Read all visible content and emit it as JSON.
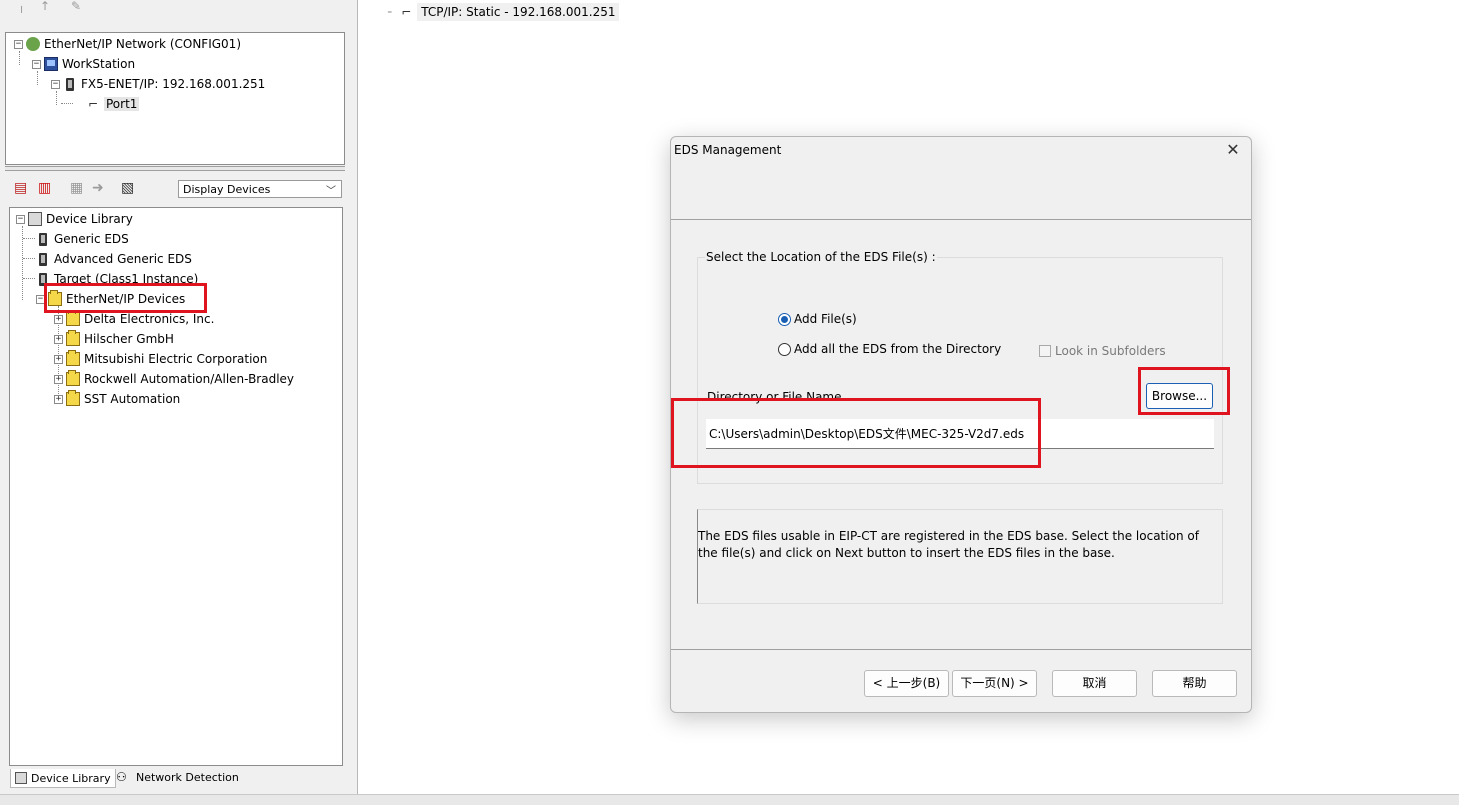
{
  "network_tree": {
    "root_label": "EtherNet/IP Network (CONFIG01)",
    "workstation_label": "WorkStation",
    "device_label": "FX5-ENET/IP: 192.168.001.251",
    "port_label": "Port1"
  },
  "library_toolbar": {
    "display_select_value": "Display Devices"
  },
  "library_tree": {
    "root_label": "Device Library",
    "items": [
      {
        "label": "Generic EDS"
      },
      {
        "label": "Advanced Generic EDS"
      },
      {
        "label": "Target (Class1 Instance)"
      },
      {
        "label": "EtherNet/IP Devices"
      }
    ],
    "vendors": [
      {
        "label": "Delta Electronics, Inc."
      },
      {
        "label": "Hilscher GmbH"
      },
      {
        "label": "Mitsubishi Electric Corporation"
      },
      {
        "label": "Rockwell Automation/Allen-Bradley"
      },
      {
        "label": "SST Automation"
      }
    ]
  },
  "bottom_tabs": {
    "device_library": "Device Library",
    "network_detection": "Network Detection"
  },
  "header": {
    "tcpip_label": "TCP/IP: Static - 192.168.001.251"
  },
  "dialog": {
    "title": "EDS Management",
    "close_glyph": "✕",
    "location_group_label": "Select the Location of the EDS File(s) :",
    "radio_add_files": "Add File(s)",
    "radio_add_directory": "Add all the EDS from the Directory",
    "checkbox_subfolders": "Look in Subfolders",
    "directory_label": "Directory or File Name",
    "path_value": "C:\\Users\\admin\\Desktop\\EDS文件\\MEC-325-V2d7.eds",
    "browse_label": "Browse...",
    "info_text": "The EDS files usable in EIP-CT are registered in the EDS base. Select the location of the file(s) and click on Next button to insert the EDS files in the base.",
    "back_label": "< 上一步(B)",
    "next_label": "下一页(N) >",
    "cancel_label": "取消",
    "help_label": "帮助"
  },
  "colors": {
    "annotation_red": "#e0141e",
    "accent_blue": "#1a5fb4"
  }
}
